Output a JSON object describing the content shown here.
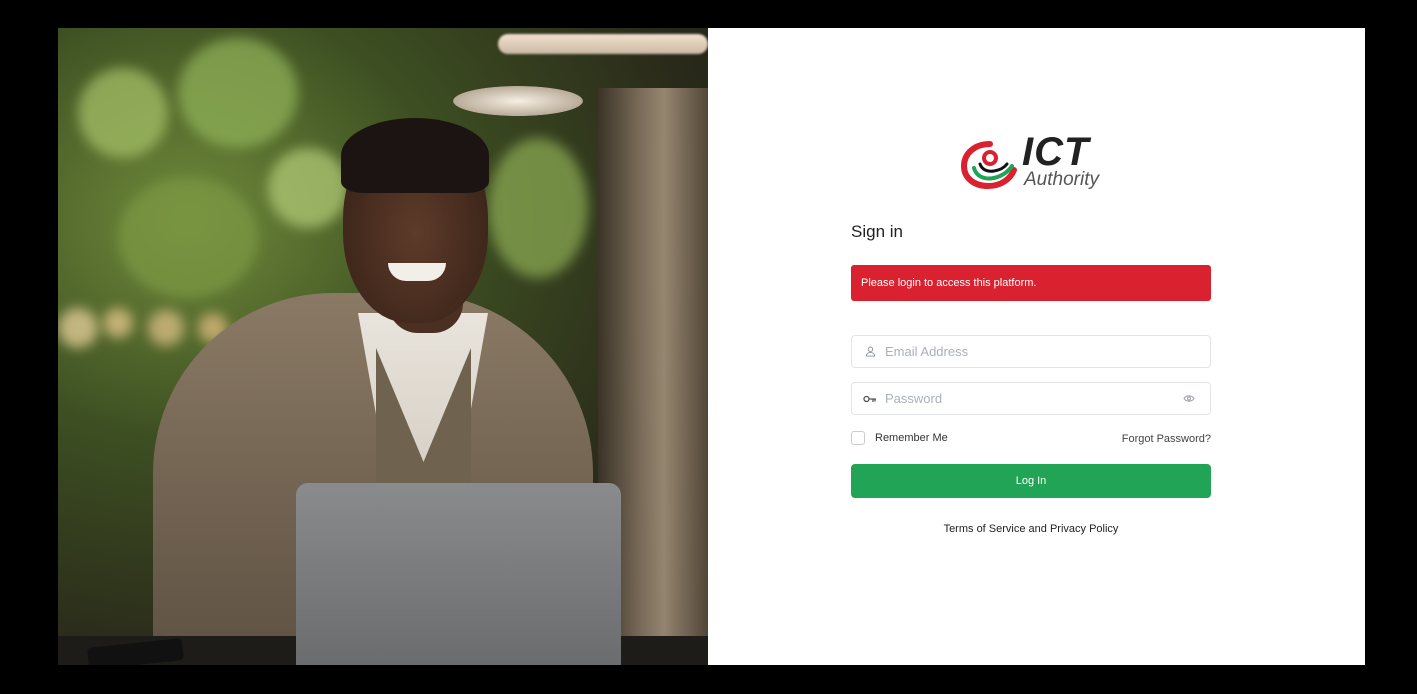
{
  "logo": {
    "wordmark": "ICT",
    "subtitle": "Authority"
  },
  "form": {
    "title": "Sign in",
    "alert_message": "Please login to access this platform.",
    "email_placeholder": "Email Address",
    "email_value": "",
    "password_placeholder": "Password",
    "password_value": "",
    "remember_label": "Remember Me",
    "forgot_label": "Forgot Password?",
    "submit_label": "Log In"
  },
  "footer": {
    "terms_label": "Terms of Service",
    "and_text": " and ",
    "privacy_label": "Privacy Policy"
  },
  "icons": {
    "email": "user-icon",
    "password": "key-icon",
    "toggle": "eye-icon"
  },
  "colors": {
    "alert": "#d9212f",
    "primary_button": "#21a455",
    "logo_red": "#d9212f",
    "logo_green": "#21a455"
  }
}
